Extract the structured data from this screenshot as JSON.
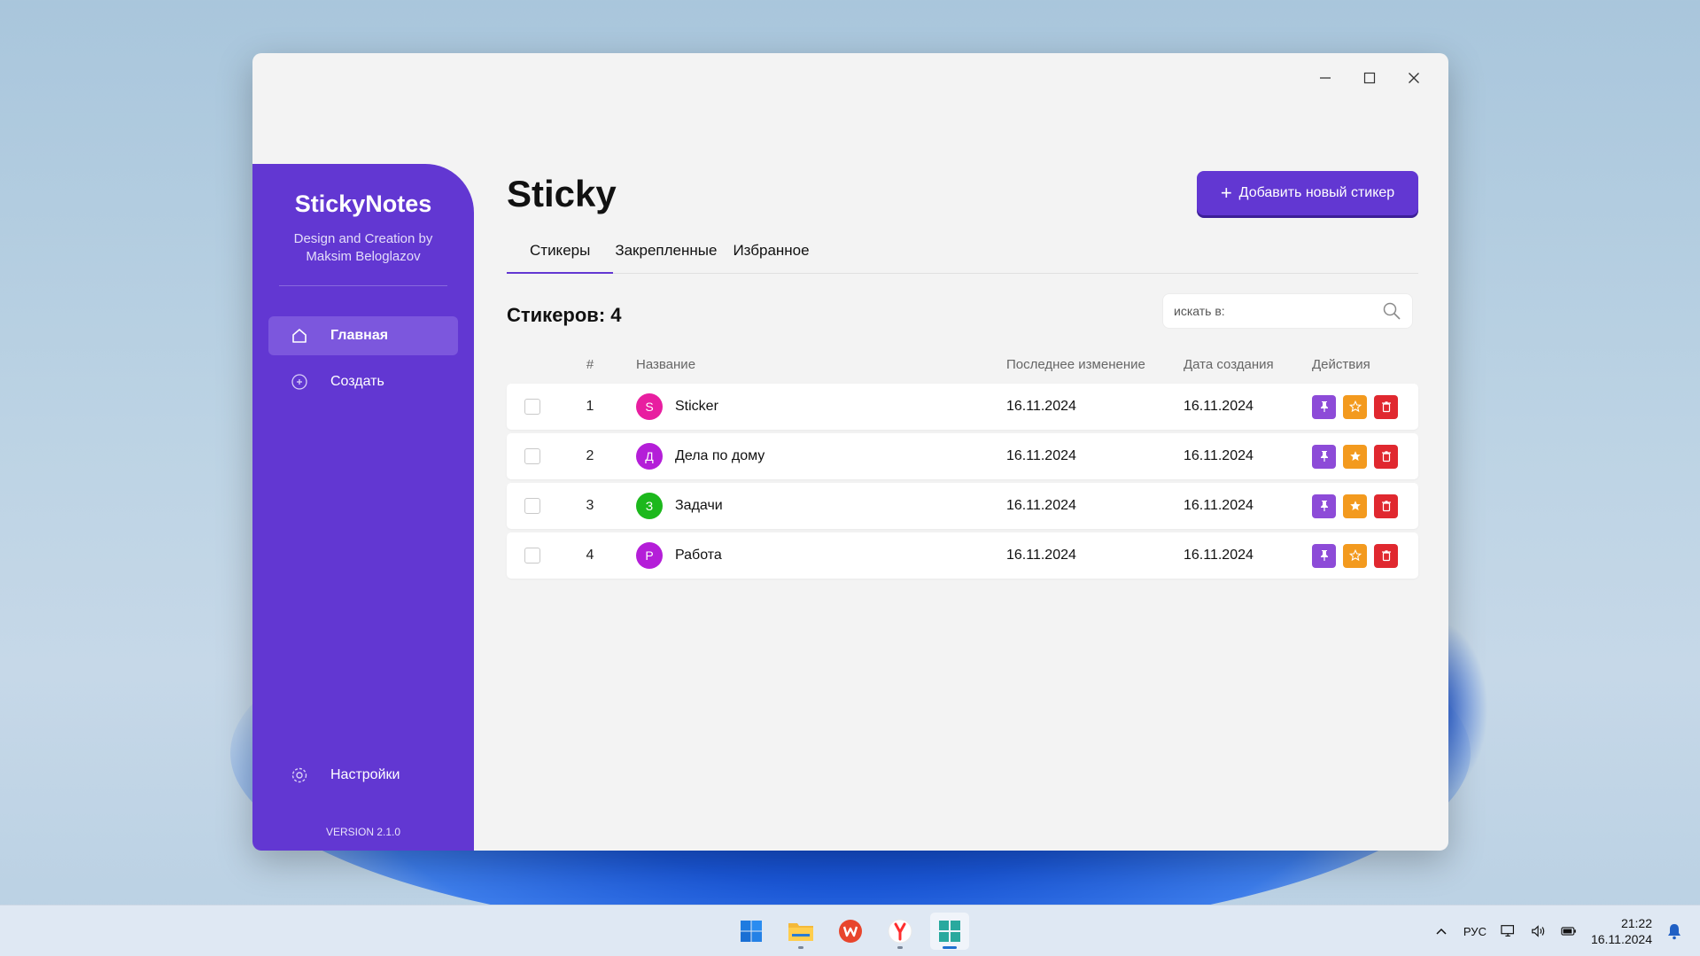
{
  "window": {
    "controls": {
      "minimize": "—",
      "maximize": "☐",
      "close": "✕"
    }
  },
  "sidebar": {
    "brand": "StickyNotes",
    "subtitle_line1": "Design and Creation by",
    "subtitle_line2": "Maksim Beloglazov",
    "nav": [
      {
        "label": "Главная",
        "icon": "home-icon",
        "active": true
      },
      {
        "label": "Создать",
        "icon": "plus-circle-icon",
        "active": false
      }
    ],
    "settings_label": "Настройки",
    "version": "VERSION 2.1.0",
    "color": "#6237d2"
  },
  "main": {
    "title": "Sticky",
    "add_button": "Добавить новый стикер",
    "tabs": [
      "Стикеры",
      "Закрепленные",
      "Избранное"
    ],
    "count_label": "Стикеров: 4",
    "search_placeholder": "искать в:",
    "columns": {
      "num": "#",
      "name": "Название",
      "modified": "Последнее изменение",
      "created": "Дата создания",
      "actions": "Действия"
    },
    "rows": [
      {
        "num": "1",
        "letter": "S",
        "color": "#e81ea0",
        "name": "Sticker",
        "modified": "16.11.2024",
        "created": "16.11.2024"
      },
      {
        "num": "2",
        "letter": "Д",
        "color": "#b41ed8",
        "name": "Дела по дому",
        "modified": "16.11.2024",
        "created": "16.11.2024"
      },
      {
        "num": "3",
        "letter": "З",
        "color": "#1cb81c",
        "name": "Задачи",
        "modified": "16.11.2024",
        "created": "16.11.2024"
      },
      {
        "num": "4",
        "letter": "Р",
        "color": "#b41ed8",
        "name": "Работа",
        "modified": "16.11.2024",
        "created": "16.11.2024"
      }
    ]
  },
  "taskbar": {
    "apps": [
      "start-icon",
      "file-explorer-icon",
      "wps-office-icon",
      "yandex-browser-icon",
      "app-grid-icon"
    ],
    "lang": "РУС",
    "time": "21:22",
    "date": "16.11.2024"
  }
}
